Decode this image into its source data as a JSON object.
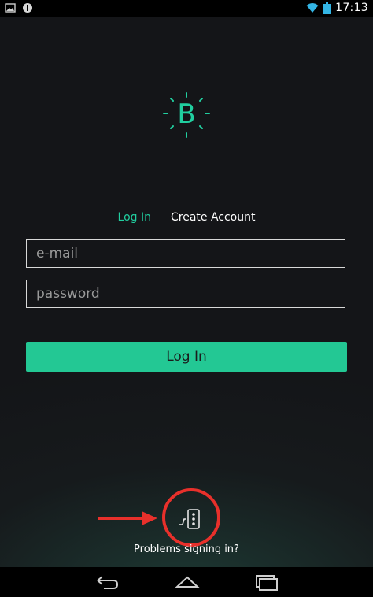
{
  "status_bar": {
    "time": "17:13",
    "left_icons": [
      "image-icon",
      "blynk-notification-icon"
    ],
    "right_icons": [
      "wifi-icon",
      "battery-icon"
    ]
  },
  "logo": {
    "letter": "B",
    "accent": "#21cfa0"
  },
  "tabs": {
    "login": "Log In",
    "create": "Create Account"
  },
  "form": {
    "email_placeholder": "e-mail",
    "email_value": "",
    "password_placeholder": "password",
    "password_value": ""
  },
  "login_button": {
    "label": "Log In",
    "color": "#23c894"
  },
  "problems": {
    "label": "Problems signing in?"
  },
  "annotation": {
    "color": "#e8302b"
  },
  "nav_bar": {
    "icons": [
      "back-icon",
      "home-icon",
      "recents-icon"
    ]
  }
}
